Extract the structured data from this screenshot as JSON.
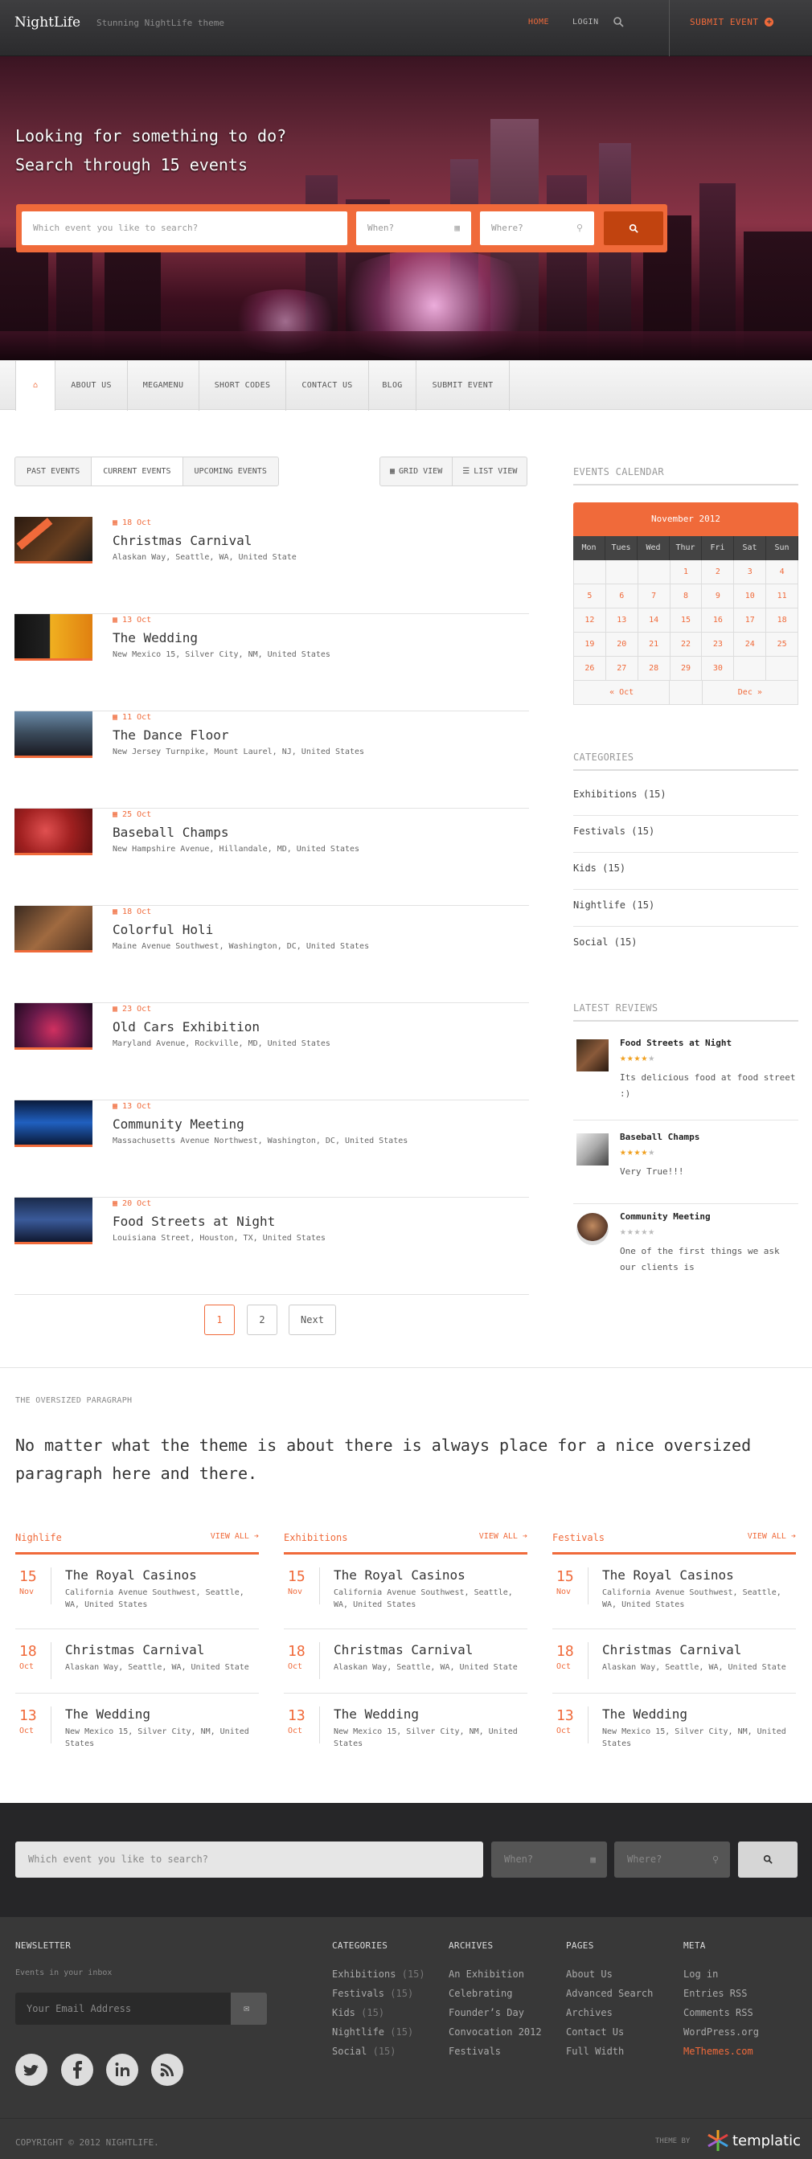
{
  "colors": {
    "accent": "#f06a3a",
    "dark": "#383838"
  },
  "header": {
    "logo": "NightLife",
    "tagline": "Stunning NightLife theme",
    "nav": {
      "home": "HOME",
      "login": "LOGIN"
    },
    "submit": "SUBMIT EVENT"
  },
  "hero": {
    "line1": "Looking for something to do?",
    "line2": "Search through 15 events",
    "search": {
      "placeholder": "Which event you like to search?",
      "when": "When?",
      "where": "Where?"
    }
  },
  "mainnav": {
    "items": [
      "ABOUT US",
      "MEGAMENU",
      "SHORT CODES",
      "CONTACT US",
      "BLOG",
      "SUBMIT EVENT"
    ]
  },
  "filters": {
    "tabs": [
      "PAST EVENTS",
      "CURRENT EVENTS",
      "UPCOMING EVENTS"
    ],
    "active": 1,
    "views": [
      "GRID VIEW",
      "LIST VIEW"
    ]
  },
  "events": [
    {
      "date": "18 Oct",
      "title": "Christmas Carnival",
      "address": "Alaskan Way, Seattle, WA, United State"
    },
    {
      "date": "13 Oct",
      "title": "The Wedding",
      "address": "New Mexico 15, Silver City, NM, United States"
    },
    {
      "date": "11 Oct",
      "title": "The Dance Floor",
      "address": "New Jersey Turnpike, Mount Laurel, NJ, United States"
    },
    {
      "date": "25 Oct",
      "title": "Baseball Champs",
      "address": "New Hampshire Avenue, Hillandale, MD, United States"
    },
    {
      "date": "18 Oct",
      "title": "Colorful Holi",
      "address": "Maine Avenue Southwest, Washington, DC, United States"
    },
    {
      "date": "23 Oct",
      "title": "Old Cars Exhibition",
      "address": "Maryland Avenue, Rockville, MD, United States"
    },
    {
      "date": "13 Oct",
      "title": "Community Meeting",
      "address": "Massachusetts Avenue Northwest, Washington, DC, United States"
    },
    {
      "date": "20 Oct",
      "title": "Food Streets at Night",
      "address": "Louisiana Street, Houston, TX, United States"
    }
  ],
  "pagination": {
    "pages": [
      "1",
      "2"
    ],
    "next": "Next"
  },
  "calendar": {
    "title": "EVENTS CALENDAR",
    "month": "November 2012",
    "days": [
      "Mon",
      "Tues",
      "Wed",
      "Thur",
      "Fri",
      "Sat",
      "Sun"
    ],
    "weeks": [
      [
        "",
        "",
        "",
        "1",
        "2",
        "3",
        "4"
      ],
      [
        "5",
        "6",
        "7",
        "8",
        "9",
        "10",
        "11"
      ],
      [
        "12",
        "13",
        "14",
        "15",
        "16",
        "17",
        "18"
      ],
      [
        "19",
        "20",
        "21",
        "22",
        "23",
        "24",
        "25"
      ],
      [
        "26",
        "27",
        "28",
        "29",
        "30",
        "",
        ""
      ]
    ],
    "prev": "« Oct",
    "next": "Dec »"
  },
  "categories": {
    "title": "CATEGORIES",
    "items": [
      {
        "name": "Exhibitions",
        "count": "(15)"
      },
      {
        "name": "Festivals",
        "count": "(15)"
      },
      {
        "name": "Kids",
        "count": "(15)"
      },
      {
        "name": "Nightlife",
        "count": "(15)"
      },
      {
        "name": "Social",
        "count": "(15)"
      }
    ]
  },
  "reviews": {
    "title": "LATEST REVIEWS",
    "items": [
      {
        "title": "Food Streets at Night",
        "rating": 4,
        "text": "Its delicious food at food street :)"
      },
      {
        "title": "Baseball Champs",
        "rating": 4,
        "text": "Very True!!!"
      },
      {
        "title": "Community Meeting",
        "rating": 0,
        "text": "One of the first things we ask our clients is"
      }
    ]
  },
  "oversized": {
    "label": "THE OVERSIZED PARAGRAPH",
    "text": "No matter what the theme is about there is always place for a nice oversized paragraph here and there."
  },
  "columns": [
    {
      "title": "Nighlife",
      "viewall": "VIEW ALL"
    },
    {
      "title": "Exhibitions",
      "viewall": "VIEW ALL"
    },
    {
      "title": "Festivals",
      "viewall": "VIEW ALL"
    }
  ],
  "column_items": [
    {
      "day": "15",
      "month": "Nov",
      "title": "The Royal Casinos",
      "address": "California Avenue Southwest, Seattle, WA, United States"
    },
    {
      "day": "18",
      "month": "Oct",
      "title": "Christmas Carnival",
      "address": "Alaskan Way, Seattle, WA, United State"
    },
    {
      "day": "13",
      "month": "Oct",
      "title": "The Wedding",
      "address": "New Mexico 15, Silver City, NM, United States"
    }
  ],
  "footer_search": {
    "placeholder": "Which event you like to search?",
    "when": "When?",
    "where": "Where?"
  },
  "footer": {
    "newsletter": {
      "title": "NEWSLETTER",
      "subtitle": "Events in your inbox",
      "placeholder": "Your Email Address"
    },
    "categories": {
      "title": "CATEGORIES",
      "items": [
        {
          "name": "Exhibitions",
          "count": "(15)"
        },
        {
          "name": "Festivals",
          "count": "(15)"
        },
        {
          "name": "Kids",
          "count": "(15)"
        },
        {
          "name": "Nightlife",
          "count": "(15)"
        },
        {
          "name": "Social",
          "count": "(15)"
        }
      ]
    },
    "archives": {
      "title": "ARCHIVES",
      "items": [
        "An Exhibition",
        "Celebrating",
        "Founder’s Day",
        "Convocation 2012",
        "Festivals"
      ]
    },
    "pages": {
      "title": "PAGES",
      "items": [
        "About Us",
        "Advanced Search",
        "Archives",
        "Contact Us",
        "Full Width"
      ]
    },
    "meta": {
      "title": "META",
      "items": [
        "Log in",
        "Entries RSS",
        "Comments RSS",
        "WordPress.org",
        "MeThemes.com"
      ]
    },
    "copyright": "COPYRIGHT © 2012 NIGHTLIFE.",
    "theme_by": "THEME BY",
    "brand": "templatic"
  }
}
